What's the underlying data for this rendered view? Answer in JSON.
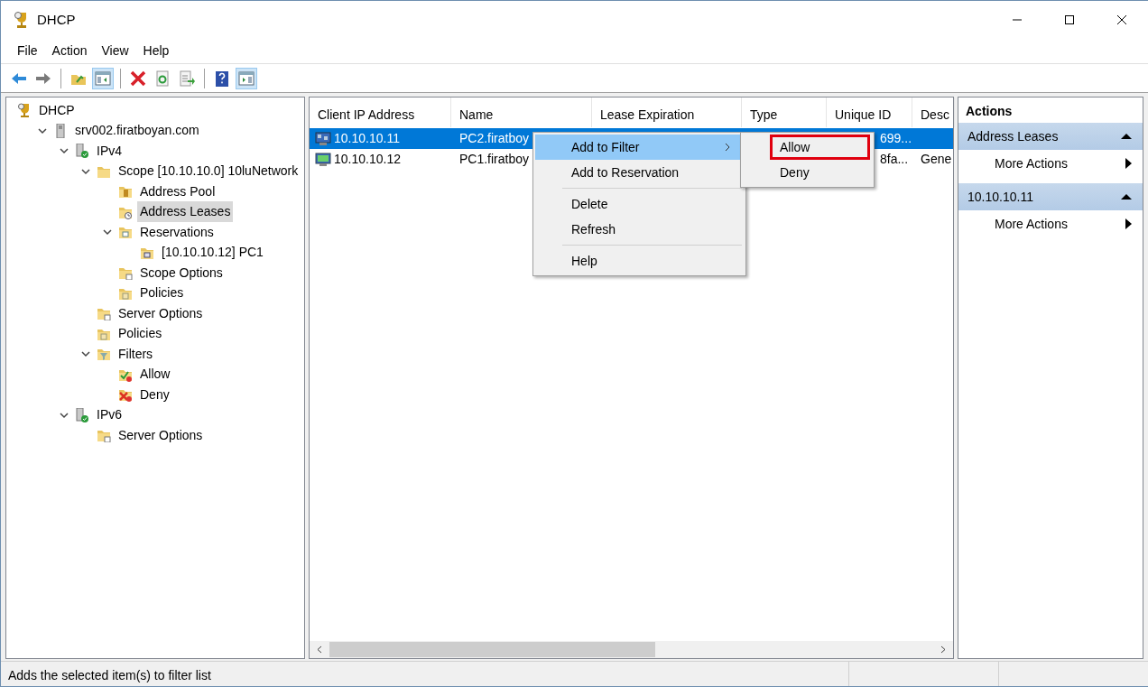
{
  "window": {
    "title": "DHCP"
  },
  "menu": [
    "File",
    "Action",
    "View",
    "Help"
  ],
  "toolbar": [
    {
      "kind": "back",
      "pressed": false
    },
    {
      "kind": "forward",
      "pressed": false
    },
    {
      "kind": "separator"
    },
    {
      "kind": "up",
      "pressed": false
    },
    {
      "kind": "tree-pane",
      "pressed": true
    },
    {
      "kind": "separator"
    },
    {
      "kind": "delete",
      "pressed": false
    },
    {
      "kind": "refresh",
      "pressed": false
    },
    {
      "kind": "export",
      "pressed": false
    },
    {
      "kind": "separator"
    },
    {
      "kind": "help",
      "pressed": false
    },
    {
      "kind": "action-pane",
      "pressed": true
    }
  ],
  "tree": [
    {
      "label": "DHCP",
      "kind": "dhcp",
      "selected": false,
      "children": [
        {
          "label": "srv002.firatboyan.com",
          "kind": "server",
          "selected": false,
          "expanded": true,
          "children": [
            {
              "label": "IPv4",
              "kind": "ip",
              "selected": false,
              "expanded": true,
              "children": [
                {
                  "label": "Scope [10.10.10.0] 10luNetwork",
                  "kind": "folder",
                  "selected": false,
                  "expanded": true,
                  "children": [
                    {
                      "label": "Address Pool",
                      "kind": "pool",
                      "selected": false
                    },
                    {
                      "label": "Address Leases",
                      "kind": "leases",
                      "selected": true
                    },
                    {
                      "label": "Reservations",
                      "kind": "reservations",
                      "selected": false,
                      "expanded": true,
                      "children": [
                        {
                          "label": "[10.10.10.12] PC1",
                          "kind": "reservation",
                          "selected": false
                        }
                      ]
                    },
                    {
                      "label": "Scope Options",
                      "kind": "options",
                      "selected": false
                    },
                    {
                      "label": "Policies",
                      "kind": "policies",
                      "selected": false
                    }
                  ]
                },
                {
                  "label": "Server Options",
                  "kind": "options",
                  "selected": false
                },
                {
                  "label": "Policies",
                  "kind": "policies",
                  "selected": false
                },
                {
                  "label": "Filters",
                  "kind": "filter",
                  "selected": false,
                  "expanded": true,
                  "children": [
                    {
                      "label": "Allow",
                      "kind": "allow",
                      "selected": false
                    },
                    {
                      "label": "Deny",
                      "kind": "deny",
                      "selected": false
                    }
                  ]
                }
              ]
            },
            {
              "label": "IPv6",
              "kind": "ip",
              "selected": false,
              "expanded": true,
              "children": [
                {
                  "label": "Server Options",
                  "kind": "options",
                  "selected": false
                }
              ]
            }
          ]
        }
      ]
    }
  ],
  "table": {
    "columns": [
      "Client IP Address",
      "Name",
      "Lease Expiration",
      "Type",
      "Unique ID",
      "Desc"
    ],
    "rows": [
      {
        "ip": "10.10.10.11",
        "name": "PC2.firatboy",
        "unique_id": "699...",
        "selected": true,
        "reserved": false
      },
      {
        "ip": "10.10.10.12",
        "name": "PC1.firatboy",
        "unique_id": "8fa...",
        "description": "Gene",
        "selected": false,
        "reserved": true
      }
    ]
  },
  "context_menu": {
    "items": [
      {
        "kind": "item",
        "label": "Add to Filter",
        "submenu": true,
        "selected": true
      },
      {
        "kind": "item",
        "label": "Add to Reservation",
        "submenu": false,
        "selected": false
      },
      {
        "kind": "separator"
      },
      {
        "kind": "item",
        "label": "Delete",
        "submenu": false,
        "selected": false
      },
      {
        "kind": "item",
        "label": "Refresh",
        "submenu": false,
        "selected": false
      },
      {
        "kind": "separator"
      },
      {
        "kind": "item",
        "label": "Help",
        "submenu": false,
        "selected": false
      }
    ],
    "submenu": [
      {
        "label": "Allow",
        "outlined": true
      },
      {
        "label": "Deny",
        "outlined": false
      }
    ]
  },
  "actions": {
    "title": "Actions",
    "sections": [
      {
        "title": "Address Leases",
        "expanded": true,
        "items": [
          "More Actions"
        ]
      },
      {
        "title": "10.10.10.11",
        "expanded": true,
        "items": [
          "More Actions"
        ]
      }
    ]
  },
  "status_bar": {
    "text": "Adds the selected item(s) to filter list"
  }
}
